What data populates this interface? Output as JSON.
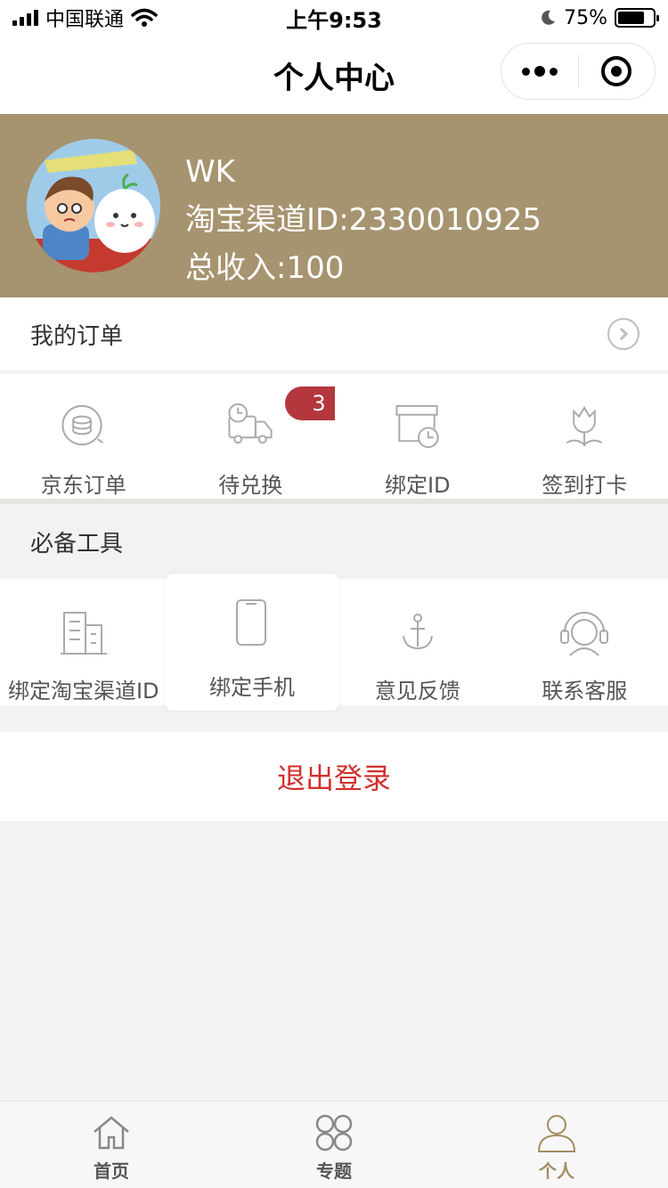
{
  "status_bar": {
    "carrier": "中国联通",
    "time": "上午9:53",
    "battery": "75%",
    "battery_level": 0.75
  },
  "nav": {
    "title": "个人中心"
  },
  "profile": {
    "name": "WK",
    "taobao_id": "淘宝渠道ID:2330010925",
    "income": "总收入:100"
  },
  "orders": {
    "title": "我的订单",
    "items": [
      {
        "label": "京东订单",
        "icon": "coin-stack-icon"
      },
      {
        "label": "待兑换",
        "icon": "delivery-truck-icon",
        "badge": "3"
      },
      {
        "label": "绑定ID",
        "icon": "box-clock-icon"
      },
      {
        "label": "签到打卡",
        "icon": "tulip-icon"
      }
    ]
  },
  "tools": {
    "title": "必备工具",
    "items": [
      {
        "label": "绑定淘宝渠道ID",
        "icon": "building-icon"
      },
      {
        "label": "绑定手机",
        "icon": "phone-icon"
      },
      {
        "label": "意见反馈",
        "icon": "anchor-icon"
      },
      {
        "label": "联系客服",
        "icon": "headset-icon"
      }
    ]
  },
  "logout": {
    "label": "退出登录"
  },
  "tabbar": {
    "items": [
      {
        "label": "首页",
        "icon": "home-icon"
      },
      {
        "label": "专题",
        "icon": "clover-icon"
      },
      {
        "label": "个人",
        "icon": "person-icon"
      }
    ],
    "active_index": 2
  },
  "colors": {
    "header_bg": "#a6936f",
    "badge": "#b3373c",
    "logout_text": "#d0302e",
    "active_tab": "#a38d63"
  }
}
